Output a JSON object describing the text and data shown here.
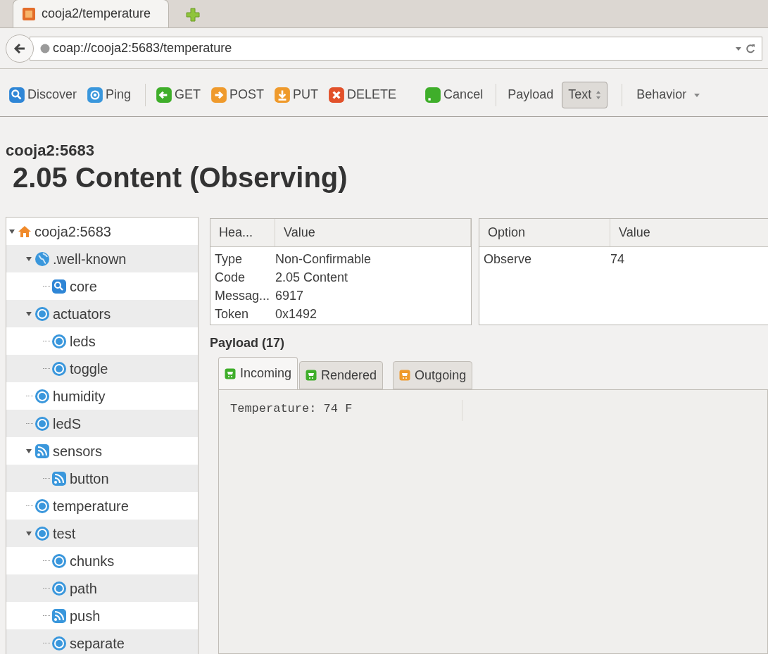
{
  "browser": {
    "tab_title": "cooja2/temperature",
    "url": "coap://cooja2:5683/temperature"
  },
  "toolbar": {
    "buttons": [
      {
        "kind": "discover",
        "label": "Discover"
      },
      {
        "kind": "ping",
        "label": "Ping"
      },
      {
        "kind": "get",
        "label": "GET"
      },
      {
        "kind": "post",
        "label": "POST"
      },
      {
        "kind": "put",
        "label": "PUT"
      },
      {
        "kind": "delete",
        "label": "DELETE"
      },
      {
        "kind": "cancel",
        "label": "Cancel"
      }
    ],
    "payload_label": "Payload",
    "payload_format": "Text",
    "behavior_menu": "Behavior"
  },
  "host": "cooja2:5683",
  "status": "2.05 Content (Observing)",
  "tree": [
    {
      "label": "cooja2:5683",
      "kind": "home",
      "expanded": true,
      "children": [
        {
          "label": ".well-known",
          "kind": "globe",
          "expanded": true,
          "children": [
            {
              "label": "core",
              "kind": "search"
            }
          ]
        },
        {
          "label": "actuators",
          "kind": "resource",
          "expanded": true,
          "children": [
            {
              "label": "leds",
              "kind": "resource"
            },
            {
              "label": "toggle",
              "kind": "resource"
            }
          ]
        },
        {
          "label": "humidity",
          "kind": "resource"
        },
        {
          "label": "ledS",
          "kind": "resource"
        },
        {
          "label": "sensors",
          "kind": "observable",
          "expanded": true,
          "children": [
            {
              "label": "button",
              "kind": "observable"
            }
          ]
        },
        {
          "label": "temperature",
          "kind": "resource"
        },
        {
          "label": "test",
          "kind": "resource",
          "expanded": true,
          "children": [
            {
              "label": "chunks",
              "kind": "resource"
            },
            {
              "label": "path",
              "kind": "resource"
            },
            {
              "label": "push",
              "kind": "observable"
            },
            {
              "label": "separate",
              "kind": "resource"
            }
          ]
        }
      ]
    }
  ],
  "headers": {
    "columns": [
      "Hea...",
      "Value"
    ],
    "rows": [
      [
        "Type",
        "Non-Confirmable"
      ],
      [
        "Code",
        "2.05 Content"
      ],
      [
        "Messag...",
        "6917"
      ],
      [
        "Token",
        "0x1492"
      ]
    ]
  },
  "options": {
    "columns": [
      "Option",
      "Value"
    ],
    "rows": [
      [
        "Observe",
        "74"
      ]
    ]
  },
  "payload": {
    "title": "Payload (17)",
    "tabs": [
      {
        "label": "Incoming",
        "kind": "incoming",
        "selected": true
      },
      {
        "label": "Rendered",
        "kind": "rendered",
        "selected": false
      },
      {
        "label": "Outgoing",
        "kind": "outgoing",
        "selected": false
      }
    ],
    "content": "Temperature: 74 F"
  }
}
